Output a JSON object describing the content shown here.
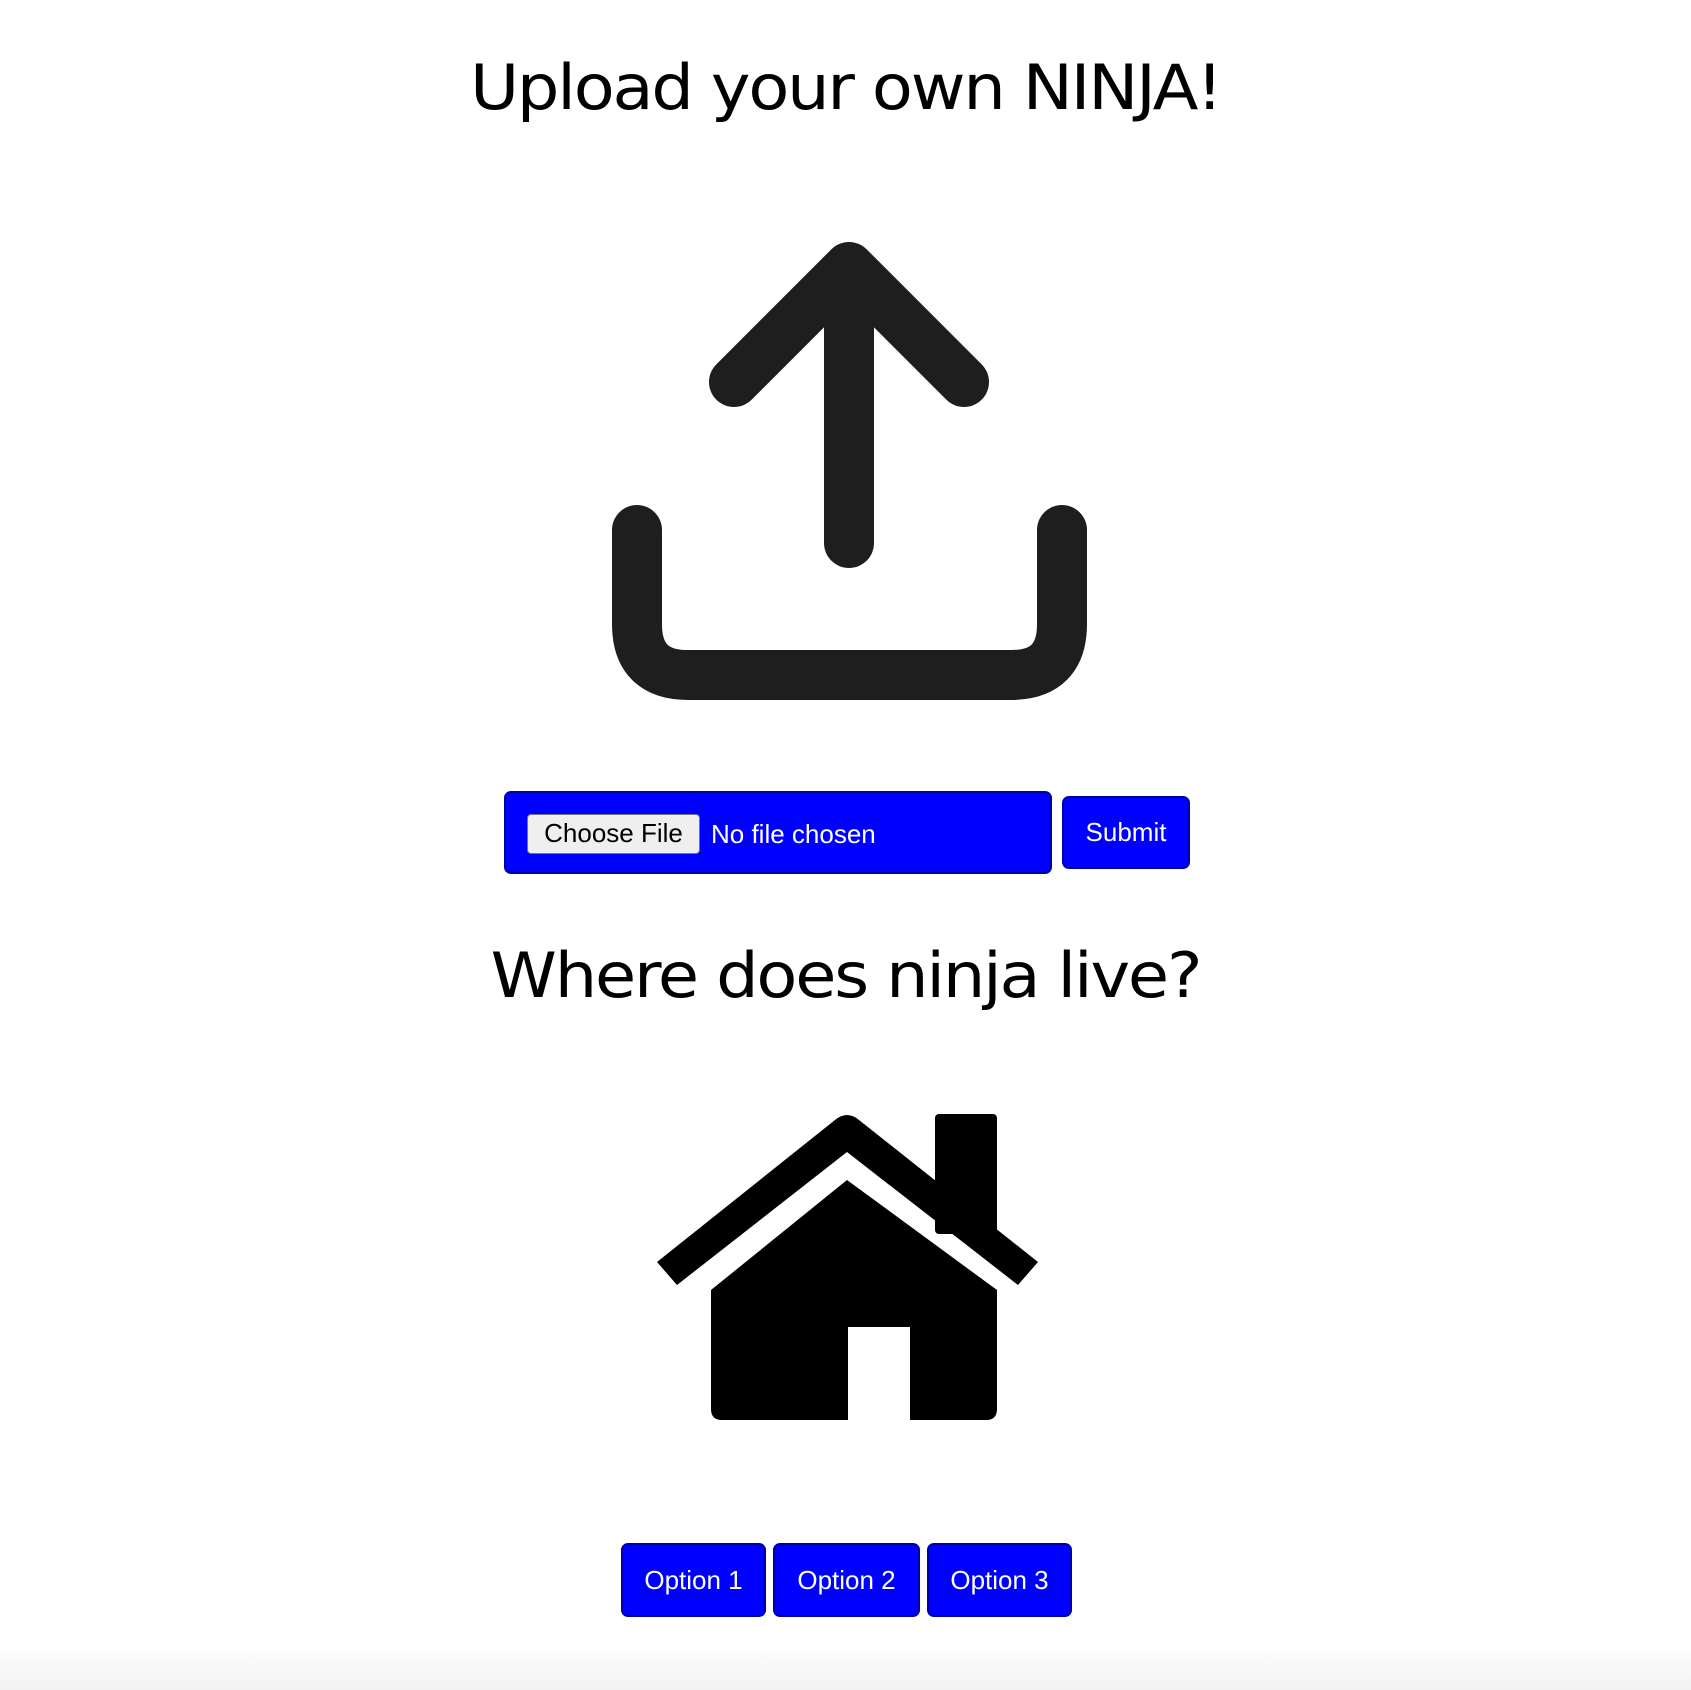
{
  "upload_section": {
    "title": "Upload your own NINJA!",
    "icon": "upload-icon",
    "file_input": {
      "button_label": "Choose File",
      "status": "No file chosen"
    },
    "submit_label": "Submit"
  },
  "location_section": {
    "title": "Where does ninja live?",
    "icon": "house-icon",
    "options": [
      {
        "label": "Option 1"
      },
      {
        "label": "Option 2"
      },
      {
        "label": "Option 3"
      }
    ]
  },
  "colors": {
    "button_background": "#0000ff",
    "button_text": "#ffffff",
    "icon_upload": "#1e1e1e",
    "icon_house": "#000000",
    "page_background": "#ffffff"
  }
}
